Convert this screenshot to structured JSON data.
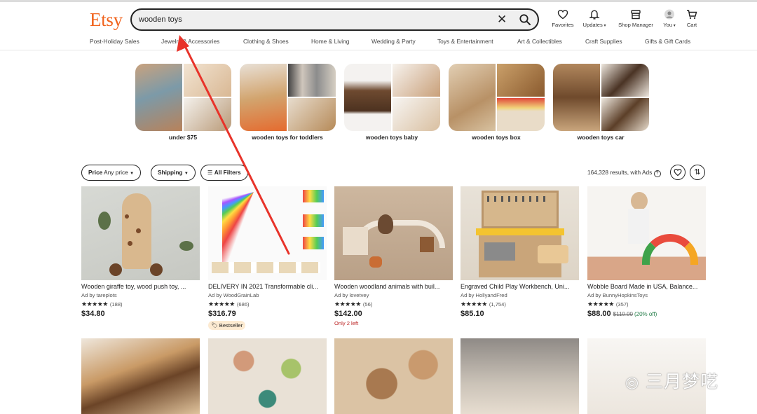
{
  "brand": {
    "logo": "Etsy",
    "color": "#f1641e"
  },
  "search": {
    "value": "wooden toys",
    "clear_icon": "close-icon",
    "submit_icon": "search-icon"
  },
  "header_actions": [
    {
      "label": "Favorites",
      "icon": "heart-icon"
    },
    {
      "label": "Updates",
      "icon": "bell-icon"
    },
    {
      "label": "Shop Manager",
      "icon": "shop-icon"
    },
    {
      "label": "You",
      "icon": "avatar-icon"
    },
    {
      "label": "Cart",
      "icon": "cart-icon"
    }
  ],
  "categories": [
    "Post-Holiday Sales",
    "Jewelry & Accessories",
    "Clothing & Shoes",
    "Home & Living",
    "Wedding & Party",
    "Toys & Entertainment",
    "Art & Collectibles",
    "Craft Supplies",
    "Gifts & Gift Cards"
  ],
  "suggestions": [
    "under $75",
    "wooden toys for toddlers",
    "wooden toys baby",
    "wooden toys box",
    "wooden toys car"
  ],
  "filters": {
    "price_label": "Price",
    "price_value": "Any price",
    "shipping": "Shipping",
    "all_filters": "All Filters",
    "results": "164,328 results, with Ads"
  },
  "listings": [
    {
      "title": "Wooden giraffe toy, wood push toy, ...",
      "shop": "Ad by tareplots",
      "rating": "★★★★★",
      "count": "(188)",
      "price": "$34.80"
    },
    {
      "title": "DELIVERY IN 2021 Transformable cli...",
      "shop": "Ad by WoodGrainLab",
      "rating": "★★★★★",
      "count": "(686)",
      "price": "$316.79",
      "badge": "Bestseller"
    },
    {
      "title": "Wooden woodland animals with buil...",
      "shop": "Ad by lovetvey",
      "rating": "★★★★★",
      "count": "(56)",
      "price": "$142.00",
      "note": "Only 2 left"
    },
    {
      "title": "Engraved Child Play Workbench, Uni...",
      "shop": "Ad by HollyandFred",
      "rating": "★★★★★",
      "count": "(1,754)",
      "price": "$85.10"
    },
    {
      "title": "Wobble Board Made in USA, Balance...",
      "shop": "Ad by BunnyHopkinsToys",
      "rating": "★★★★★",
      "count": "(357)",
      "price": "$88.00",
      "original_price": "$110.00",
      "discount": "(20% off)"
    }
  ],
  "watermark": "三月梦呓"
}
